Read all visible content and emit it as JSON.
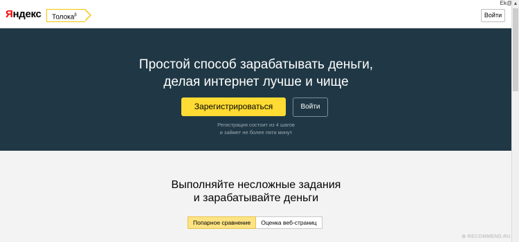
{
  "corner": {
    "text": "Ek@"
  },
  "header": {
    "logo_first": "Я",
    "logo_rest": "ндекс",
    "toloka_label": "Толока",
    "toloka_badge": "β",
    "login_label": "Войти"
  },
  "hero": {
    "title_line1": "Простой способ зарабатывать деньги,",
    "title_line2": "делая интернет лучше и чище",
    "register_label": "Зарегистрироваться",
    "login_label": "Войти",
    "note_line1": "Регистрация состоит из 4 шагов",
    "note_line2": "и займет не более пяти минут"
  },
  "tasks": {
    "title_line1": "Выполняйте несложные задания",
    "title_line2": "и зарабатывайте деньги",
    "tabs": [
      {
        "label": "Попарное сравнение",
        "active": true
      },
      {
        "label": "Оценка веб-страниц",
        "active": false
      }
    ]
  },
  "watermark": {
    "text": "✿ RECOMMEND.RU"
  },
  "colors": {
    "accent": "#ffdb33",
    "hero_bg": "#203845",
    "logo_red": "#ff0000"
  }
}
